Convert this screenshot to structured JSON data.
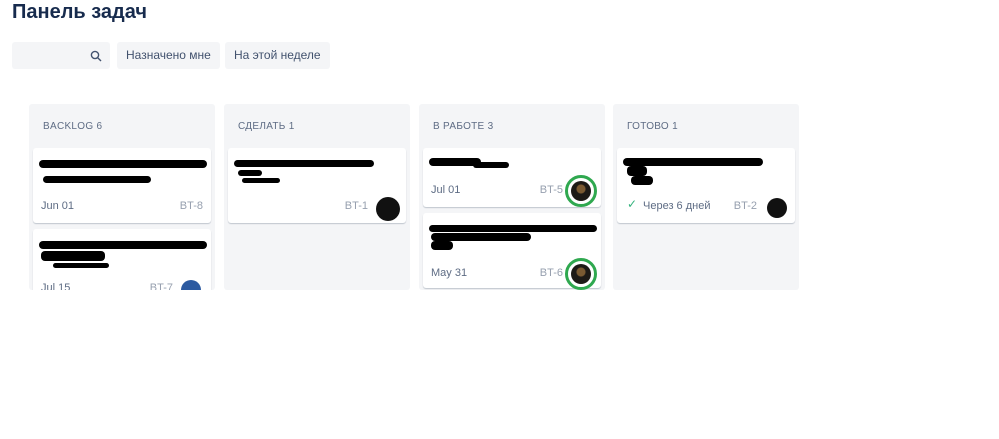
{
  "page": {
    "title": "Панель задач"
  },
  "search": {
    "placeholder": "",
    "icon": "search-icon"
  },
  "filters": [
    {
      "label": "Назначено мне"
    },
    {
      "label": "На этой неделе"
    }
  ],
  "columns": [
    {
      "header": "BACKLOG 6",
      "cards": [
        {
          "date": "Jun 01",
          "key": "BT-8"
        },
        {
          "date": "Jul 15",
          "key": "BT-7"
        }
      ]
    },
    {
      "header": "СДЕЛАТЬ 1",
      "cards": [
        {
          "key": "BT-1"
        }
      ]
    },
    {
      "header": "В РАБОТЕ 3",
      "cards": [
        {
          "date": "Jul 01",
          "key": "BT-5"
        },
        {
          "date": "May 31",
          "key": "BT-6"
        }
      ]
    },
    {
      "header": "ГОТОВО 1",
      "cards": [
        {
          "due": "Через 6 дней",
          "key": "BT-2"
        }
      ]
    }
  ],
  "colors": {
    "done_check": "#36b37e",
    "highlight_ring": "#2fa84f",
    "column_bg": "#f4f5f7"
  }
}
